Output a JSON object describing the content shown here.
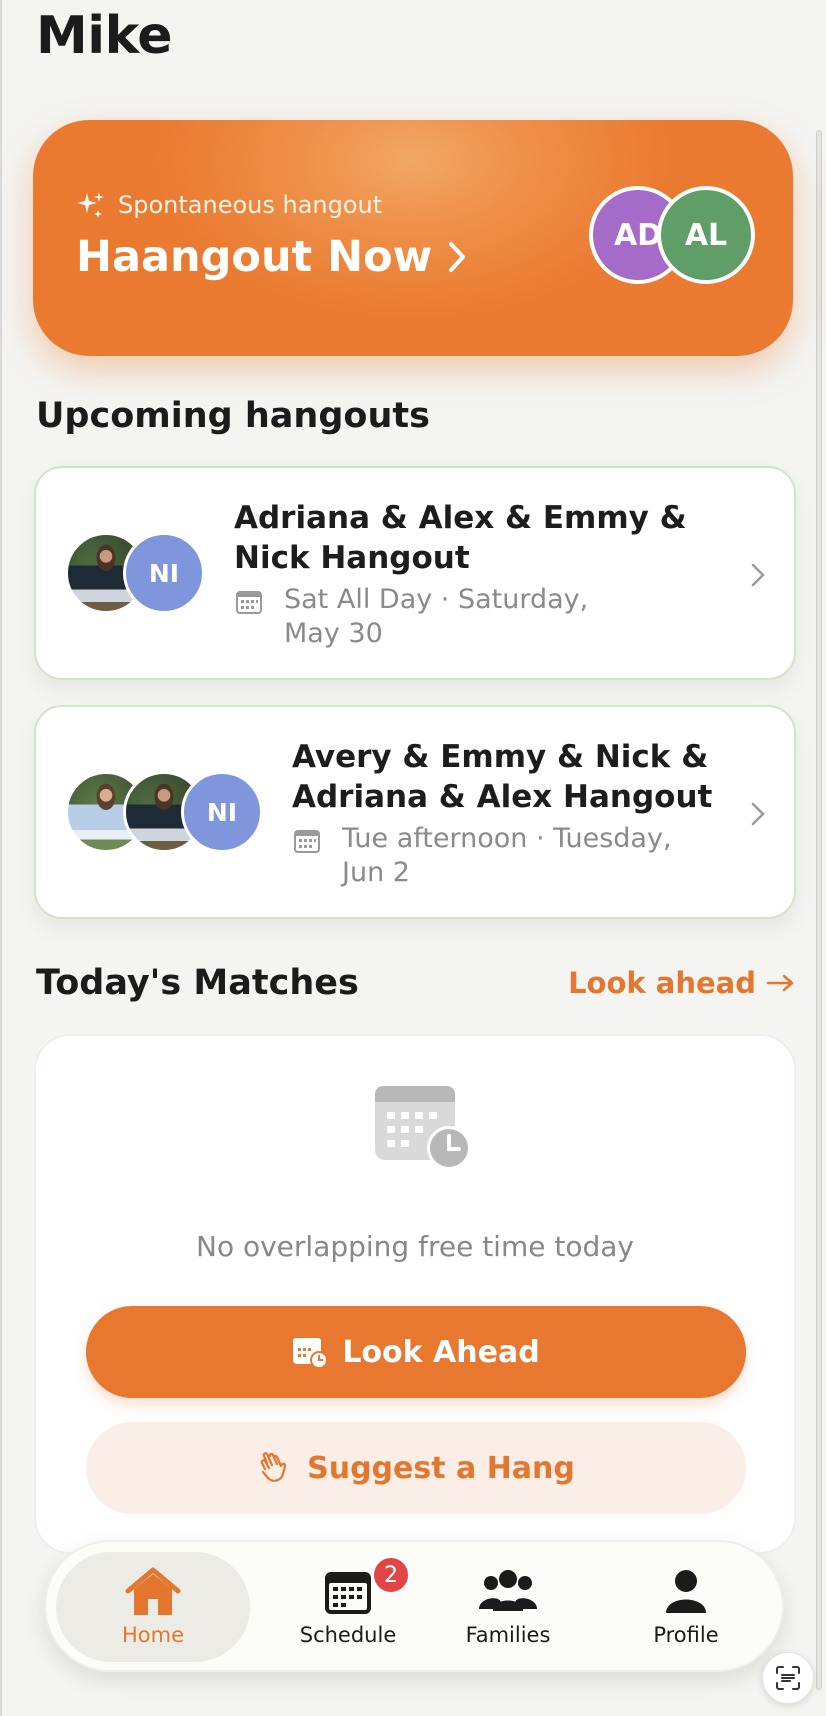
{
  "header": {
    "title": "Mike"
  },
  "hero": {
    "kicker": "Spontaneous hangout",
    "title": "Haangout Now",
    "avatars": [
      {
        "initials": "AD",
        "color": "#a46bc8"
      },
      {
        "initials": "AL",
        "color": "#5f9e66"
      }
    ]
  },
  "upcoming": {
    "title": "Upcoming hangouts",
    "items": [
      {
        "name_line1": "Adriana & Alex & Emmy &",
        "name_line2": "Nick Hangout",
        "when_line1": "Sat All Day · Saturday,",
        "when_line2": "May 30",
        "avatar_initials": "NI"
      },
      {
        "name_line1": "Avery & Emmy & Nick &",
        "name_line2": "Adriana & Alex Hangout",
        "when_line1": "Tue afternoon · Tuesday,",
        "when_line2": "Jun 2",
        "avatar_initials": "NI"
      }
    ]
  },
  "matches": {
    "title": "Today's Matches",
    "look_ahead_link": "Look ahead",
    "empty_text": "No overlapping free time today",
    "primary_button": "Look Ahead",
    "secondary_button": "Suggest a Hang"
  },
  "tabs": {
    "items": [
      {
        "label": "Home",
        "active": true
      },
      {
        "label": "Schedule",
        "badge": "2"
      },
      {
        "label": "Families"
      },
      {
        "label": "Profile"
      }
    ]
  },
  "colors": {
    "accent": "#e8772f",
    "background": "#f4f4f1",
    "card_border": "#cfe5c7",
    "initials_blue": "#7f96dc",
    "badge_red": "#e24545"
  }
}
